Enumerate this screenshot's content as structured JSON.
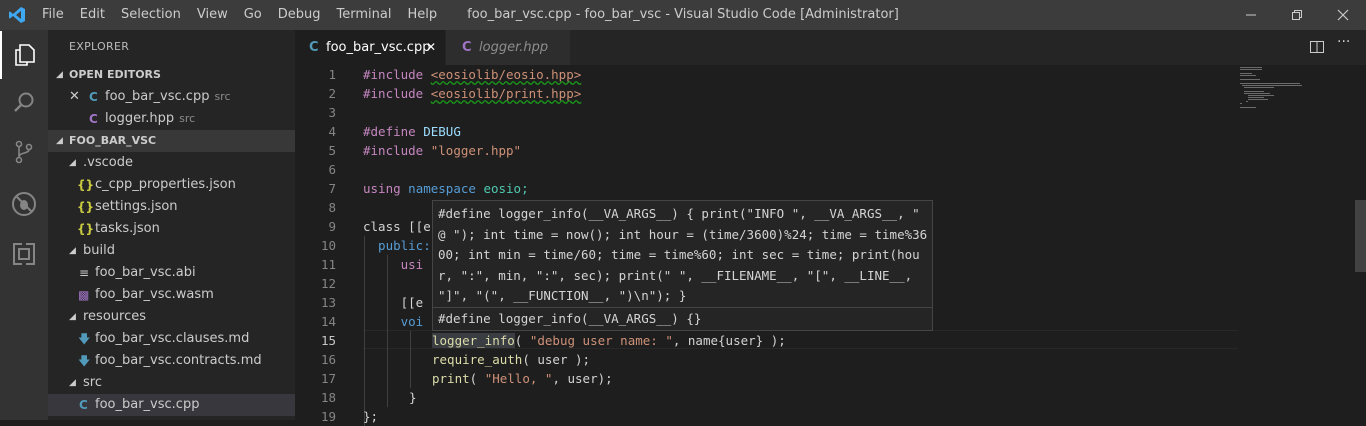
{
  "menu": [
    "File",
    "Edit",
    "Selection",
    "View",
    "Go",
    "Debug",
    "Terminal",
    "Help"
  ],
  "window_title": "foo_bar_vsc.cpp - foo_bar_vsc - Visual Studio Code [Administrator]",
  "explorer": {
    "title": "EXPLORER",
    "open_editors_header": "OPEN EDITORS",
    "open_editors": [
      {
        "name": "foo_bar_vsc.cpp",
        "hint": "src"
      },
      {
        "name": "logger.hpp",
        "hint": "src"
      }
    ],
    "project_header": "FOO_BAR_VSC",
    "tree": [
      {
        "name": ".vscode"
      },
      {
        "name": "c_cpp_properties.json"
      },
      {
        "name": "settings.json"
      },
      {
        "name": "tasks.json"
      },
      {
        "name": "build"
      },
      {
        "name": "foo_bar_vsc.abi"
      },
      {
        "name": "foo_bar_vsc.wasm"
      },
      {
        "name": "resources"
      },
      {
        "name": "foo_bar_vsc.clauses.md"
      },
      {
        "name": "foo_bar_vsc.contracts.md"
      },
      {
        "name": "src"
      },
      {
        "name": "foo_bar_vsc.cpp"
      }
    ]
  },
  "tabs": [
    {
      "label": "foo_bar_vsc.cpp",
      "active": true
    },
    {
      "label": "logger.hpp",
      "active": false
    }
  ],
  "line_numbers": [
    "1",
    "2",
    "3",
    "4",
    "5",
    "6",
    "7",
    "8",
    "9",
    "10",
    "11",
    "12",
    "13",
    "14",
    "15",
    "16",
    "17",
    "18",
    "19"
  ],
  "current_line": "15",
  "code": {
    "l1_kw": "#include",
    "l1_str": "<eosiolib/eosio.hpp>",
    "l2_kw": "#include",
    "l2_str": "<eosiolib/print.hpp>",
    "l4_kw": "#define",
    "l4_name": "DEBUG",
    "l5_kw": "#include",
    "l5_str": "\"logger.hpp\"",
    "l7_a": "using",
    "l7_b": "namespace",
    "l7_c": "eosio;",
    "l9": "class [[e",
    "l10": "  public:",
    "l11": "     usi",
    "l13": "     [[e",
    "l14": "     voi",
    "l15_fn": "logger_info",
    "l15_a": "( ",
    "l15_s": "\"debug user name: \"",
    "l15_b": ", name{user} );",
    "l16_fn": "require_auth",
    "l16_b": "( user );",
    "l17_fn": "print",
    "l17_a": "( ",
    "l17_s": "\"Hello, \"",
    "l17_b": ", user);",
    "l18": "}",
    "l19": "};"
  },
  "hover": {
    "definition": "#define logger_info(__VA_ARGS__) { print(\"INFO \", __VA_ARGS__, \" @ \"); int time = now(); int hour = (time/3600)%24; time = time%3600; int min = time/60; time = time%60; int sec = time; print(hour, \":\", min, \":\", sec); print(\" \", __FILENAME__, \"[\", __LINE__, \"]\", \"(\", __FUNCTION__, \")\\n\"); }",
    "short": "#define logger_info(__VA_ARGS__) {}"
  },
  "colors": {
    "keyword_blue": "#569cd6",
    "preproc_purple": "#c586c0",
    "string_orange": "#ce9178",
    "function_yellow": "#dcdcaa",
    "vscode_blue": "#007acc"
  },
  "icons": [
    "vscode-logo-icon",
    "explorer-icon",
    "search-icon",
    "source-control-icon",
    "debug-icon",
    "extensions-icon",
    "split-editor-icon",
    "more-actions-icon",
    "close-icon",
    "minimize-icon",
    "maximize-icon"
  ]
}
